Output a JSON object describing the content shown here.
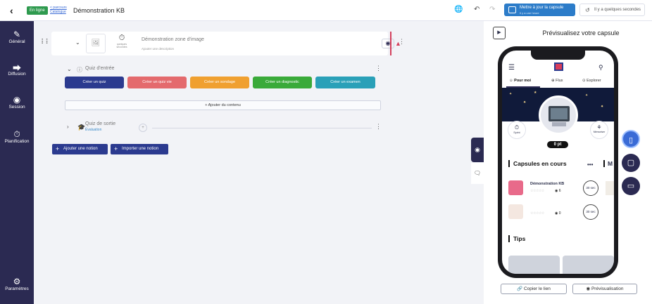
{
  "header": {
    "back_icon": "chevron-left-icon",
    "status_badge": "En ligne",
    "breadcrumb_line1": "< parcours",
    "breadcrumb_line2": "Catalogue",
    "title": "Démonstration KB",
    "update_button": "Mettre à jour la capsule",
    "update_subtext": "Il y a une heure",
    "saved_status": "Il y a quelques secondes"
  },
  "sidebar": {
    "items": [
      {
        "label": "Général",
        "icon": "brush-icon"
      },
      {
        "label": "Diffusion",
        "icon": "share-icon"
      },
      {
        "label": "Session",
        "icon": "target-icon"
      },
      {
        "label": "Planification",
        "icon": "stopwatch-icon"
      }
    ],
    "settings": "Paramètres"
  },
  "zone": {
    "timer_label": "quelques secondes",
    "title": "Démonstration zone d'image",
    "description": "Ajouter une description"
  },
  "quiz_entry": {
    "title": "Quiz d'entrée",
    "buttons": [
      {
        "label": "Créer un quiz",
        "color": "#2b3a8f"
      },
      {
        "label": "Créer un quiz vie",
        "color": "#e46a6d"
      },
      {
        "label": "Créer un sondage",
        "color": "#f0a030"
      },
      {
        "label": "Créer un diagnostic",
        "color": "#3aaa3a"
      },
      {
        "label": "Créer un examen",
        "color": "#2aa0b8"
      }
    ],
    "add_content": "Ajouter du contenu"
  },
  "quiz_exit": {
    "title": "Quiz de sortie",
    "subtitle": "Évaluation"
  },
  "actions": {
    "add_notion": "Ajouter une notion",
    "import_notion": "Importer une notion"
  },
  "preview": {
    "title": "Prévisualisez votre capsule",
    "tabs": [
      "Pour moi",
      "Flux",
      "Explorer"
    ],
    "sprint": "Sprint",
    "memorize": "Mémoriser",
    "points": "0 pt",
    "capsules_title": "Capsules en cours",
    "capsules_edge": "M",
    "rows": [
      {
        "name": "Démonstration KB",
        "views": "6",
        "time": "30 sec"
      },
      {
        "name": "",
        "views": "0",
        "time": "30 sec"
      }
    ],
    "tips_title": "Tips",
    "copy_link": "Copier le lien",
    "preview_button": "Prévisualisation"
  },
  "colors": {
    "sidebar": "#2b2a52",
    "accent": "#2b3a8f",
    "update": "#2c7cc9",
    "device_button": "#2b2a52",
    "device_active": "#3a6bd6"
  }
}
